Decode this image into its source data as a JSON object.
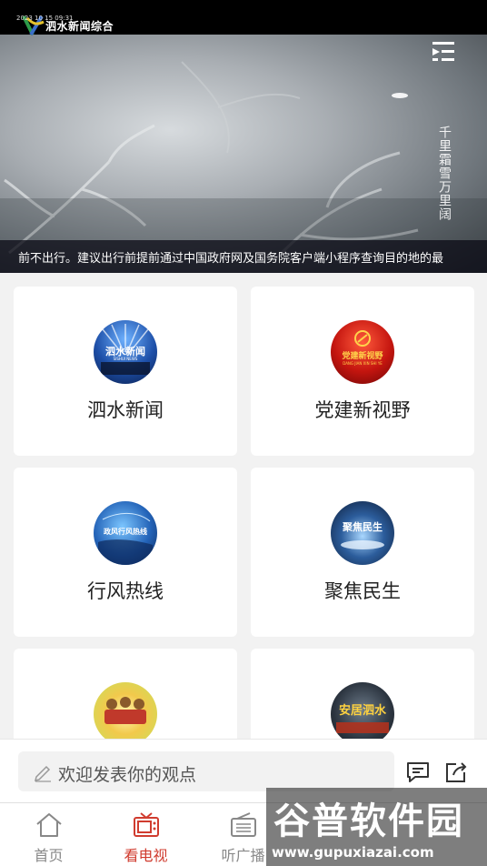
{
  "player": {
    "channel_name": "泗水新闻综合",
    "overlay_date": "2023 10 15 09:31",
    "vertical_caption": "千里霜雪万里阔",
    "ticker_text": "前不出行。建议出行前提前通过中国政府网及国务院客户端小程序查询目的地的最"
  },
  "cards": [
    {
      "title": "泗水新闻",
      "thumb_label": "泗水新闻",
      "thumb_sub": "SISHUI NEWS"
    },
    {
      "title": "党建新视野",
      "thumb_label": "党建新视野",
      "thumb_sub": "DANG JIAN XIN SHI YE"
    },
    {
      "title": "行风热线",
      "thumb_label": "政风行风热线",
      "thumb_sub": ""
    },
    {
      "title": "聚焦民生",
      "thumb_label": "聚焦民生",
      "thumb_sub": ""
    },
    {
      "title": "",
      "thumb_label": "",
      "thumb_sub": ""
    },
    {
      "title": "",
      "thumb_label": "安居泗水",
      "thumb_sub": ""
    }
  ],
  "comment": {
    "placeholder": "欢迎发表你的观点"
  },
  "tabs": [
    {
      "label": "首页",
      "icon": "home-icon"
    },
    {
      "label": "看电视",
      "icon": "tv-icon",
      "active": true
    },
    {
      "label": "听广播",
      "icon": "radio-icon"
    }
  ],
  "watermark": {
    "title": "谷普软件园",
    "url": "www.gupuxiazai.com"
  },
  "colors": {
    "accent": "#d03c2f",
    "tab_inactive": "#888888",
    "background": "#f2f2f2"
  }
}
